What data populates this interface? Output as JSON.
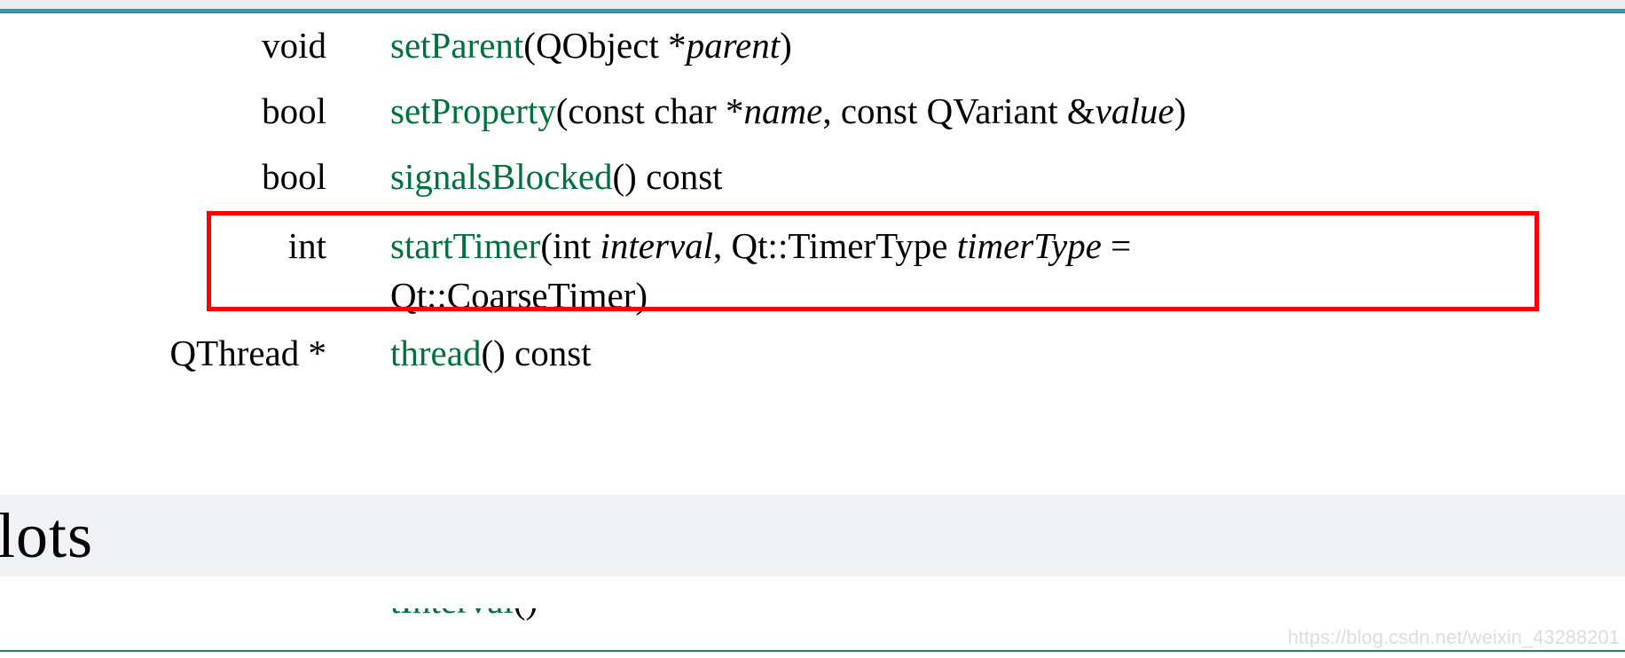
{
  "page": {
    "background_color": "#ffffff",
    "accent_rule_color": "#4a8fad",
    "function_name_color": "#00703e",
    "highlight_border_color": "#fb0007",
    "section_band_color": "#f1f2f4",
    "watermark_color": "#d8dde0"
  },
  "functions": [
    {
      "return_type": "void",
      "name": "setParent",
      "signature_before": "(QObject *",
      "param": "parent",
      "signature_after": ")",
      "highlighted": false
    },
    {
      "return_type": "bool",
      "name": "setProperty",
      "signature_before": "(const char *",
      "param": "name",
      "signature_mid": ", const QVariant &",
      "param2": "value",
      "signature_after": ")",
      "highlighted": false
    },
    {
      "return_type": "bool",
      "name": "signalsBlocked",
      "signature_before": "() const",
      "highlighted": false
    },
    {
      "return_type": "int",
      "name": "startTimer",
      "signature_before": "(int ",
      "param": "interval",
      "signature_mid": ", Qt::TimerType ",
      "param2": "timerType",
      "signature_after": " =",
      "signature_line2": "Qt::CoarseTimer)",
      "highlighted": true
    },
    {
      "return_type": "QThread *",
      "name": "thread",
      "signature_before": "() const",
      "highlighted": false
    }
  ],
  "section": {
    "title": "Slots"
  },
  "cut_off_row": {
    "return_type": "",
    "name": "tInterval",
    "signature_before": "()"
  },
  "watermark": {
    "text": "https://blog.csdn.net/weixin_43288201"
  }
}
